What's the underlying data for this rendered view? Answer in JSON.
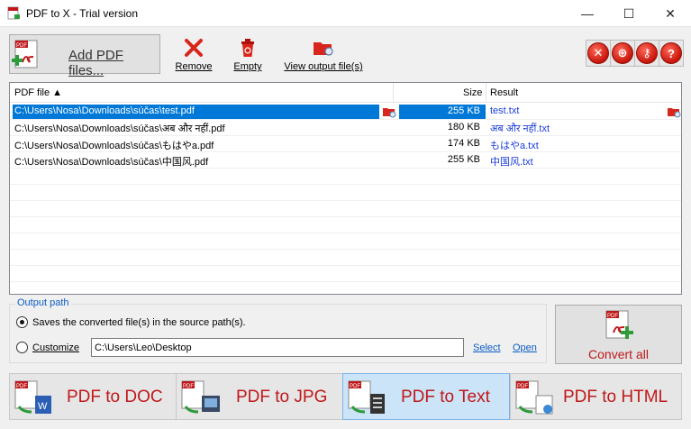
{
  "window": {
    "title": "PDF to X - Trial version",
    "minimize": "—",
    "maximize": "☐",
    "close": "✕"
  },
  "toolbar": {
    "add_label": "Add PDF files...",
    "remove_label": "Remove",
    "empty_label": "Empty",
    "view_label": "View output file(s)",
    "right_icons": [
      "tools-icon",
      "globe-icon",
      "key-icon",
      "help-icon"
    ],
    "help_glyph": "?"
  },
  "list": {
    "headers": {
      "file": "PDF file ▲",
      "size": "Size",
      "result": "Result"
    },
    "rows": [
      {
        "file": "C:\\Users\\Nosa\\Downloads\\súčas\\test.pdf",
        "size": "255 KB",
        "result": "test.txt",
        "selected": true
      },
      {
        "file": "C:\\Users\\Nosa\\Downloads\\súčas\\अब और नहीं.pdf",
        "size": "180 KB",
        "result": "अब और नहीं.txt",
        "selected": false
      },
      {
        "file": "C:\\Users\\Nosa\\Downloads\\súčas\\もはやa.pdf",
        "size": "174 KB",
        "result": "もはやa.txt",
        "selected": false
      },
      {
        "file": "C:\\Users\\Nosa\\Downloads\\súčas\\中国风.pdf",
        "size": "255 KB",
        "result": "中国风.txt",
        "selected": false
      }
    ]
  },
  "output": {
    "legend": "Output path",
    "option_source": "Saves the converted file(s) in the source path(s).",
    "option_customize": "Customize",
    "path_value": "C:\\Users\\Leo\\Desktop",
    "select_link": "Select",
    "open_link": "Open"
  },
  "convert": {
    "label": "Convert all"
  },
  "formats": [
    {
      "label": "PDF to DOC",
      "active": false
    },
    {
      "label": "PDF to JPG",
      "active": false
    },
    {
      "label": "PDF to Text",
      "active": true
    },
    {
      "label": "PDF to HTML",
      "active": false
    }
  ],
  "colors": {
    "accent": "#c0181a",
    "selection": "#0078d7",
    "link": "#0b5cc4"
  }
}
